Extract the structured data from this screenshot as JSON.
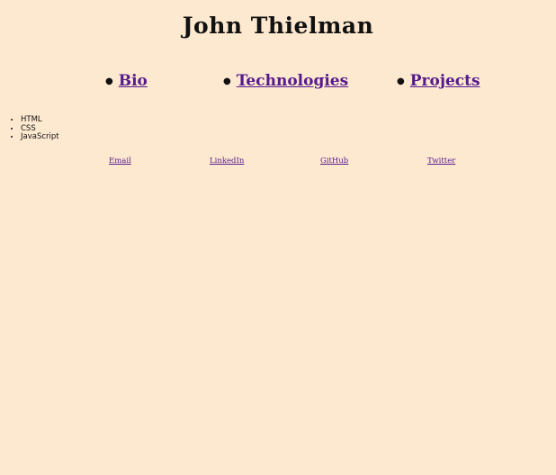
{
  "header": {
    "title": "John Thielman"
  },
  "nav": {
    "items": [
      {
        "label": "Bio"
      },
      {
        "label": "Technologies"
      },
      {
        "label": "Projects"
      }
    ]
  },
  "technologies": {
    "items": [
      "HTML",
      "CSS",
      "JavaScript"
    ]
  },
  "social": {
    "links": [
      {
        "label": "Email"
      },
      {
        "label": "LinkedIn"
      },
      {
        "label": "GitHub"
      },
      {
        "label": "Twitter"
      }
    ]
  },
  "colors": {
    "background": "#fde9d0",
    "link": "#551a8b",
    "text": "#111111"
  }
}
